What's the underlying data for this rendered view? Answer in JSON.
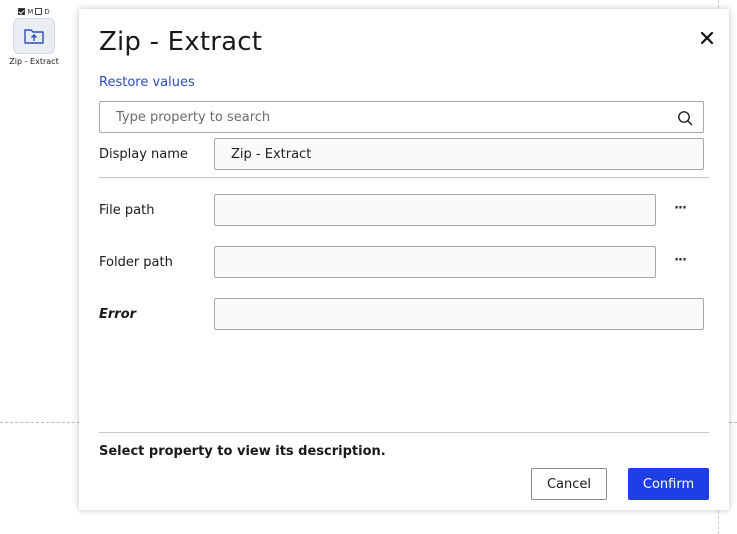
{
  "activity": {
    "flag_m": "M",
    "flag_d": "D",
    "label": "Zip - Extract",
    "icon": "folder-upload-icon"
  },
  "dialog": {
    "title": "Zip - Extract",
    "restore_label": "Restore values",
    "search": {
      "placeholder": "Type property to search",
      "value": ""
    },
    "properties": {
      "display_name": {
        "label": "Display name",
        "value": "Zip - Extract"
      },
      "file_path": {
        "label": "File path",
        "value": ""
      },
      "folder_path": {
        "label": "Folder path",
        "value": ""
      },
      "error": {
        "label": "Error",
        "value": ""
      }
    },
    "browse_label": "···",
    "description": "Select property to view its description.",
    "buttons": {
      "cancel": "Cancel",
      "confirm": "Confirm"
    }
  },
  "colors": {
    "accent": "#1f3ee6",
    "link": "#2b4fb8"
  }
}
